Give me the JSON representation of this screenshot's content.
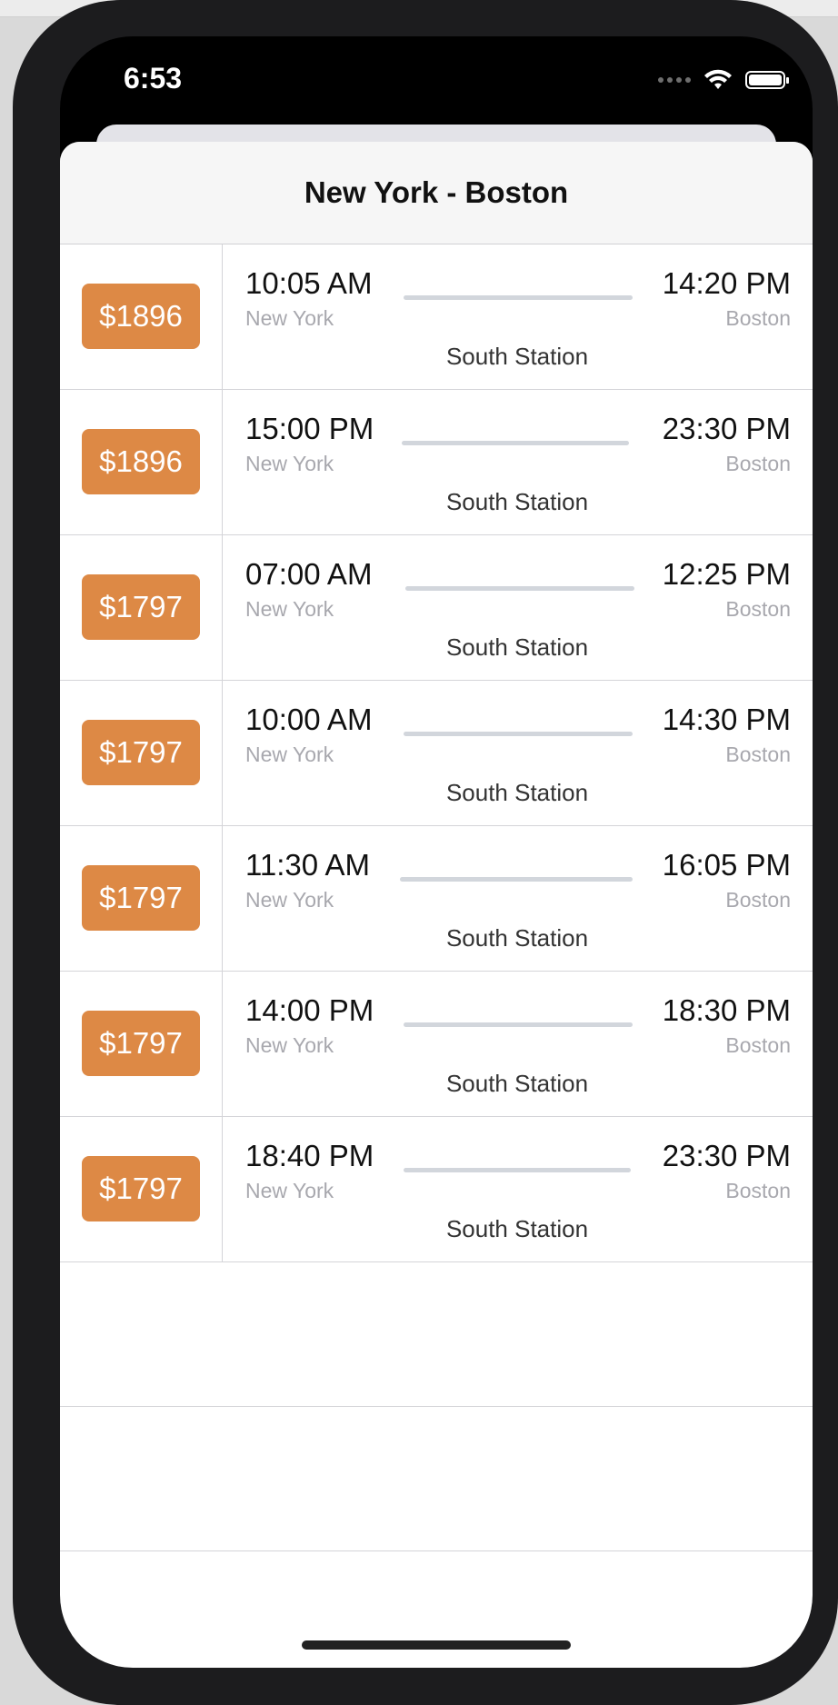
{
  "status_bar": {
    "time": "6:53"
  },
  "header": {
    "title": "New York - Boston"
  },
  "trips": [
    {
      "price": "$1896",
      "departure_time": "10:05 AM",
      "departure_city": "New York",
      "arrival_time": "14:20 PM",
      "arrival_city": "Boston",
      "station": "South Station"
    },
    {
      "price": "$1896",
      "departure_time": "15:00 PM",
      "departure_city": "New York",
      "arrival_time": "23:30 PM",
      "arrival_city": "Boston",
      "station": "South Station"
    },
    {
      "price": "$1797",
      "departure_time": "07:00 AM",
      "departure_city": "New York",
      "arrival_time": "12:25 PM",
      "arrival_city": "Boston",
      "station": "South Station"
    },
    {
      "price": "$1797",
      "departure_time": "10:00 AM",
      "departure_city": "New York",
      "arrival_time": "14:30 PM",
      "arrival_city": "Boston",
      "station": "South Station"
    },
    {
      "price": "$1797",
      "departure_time": "11:30 AM",
      "departure_city": "New York",
      "arrival_time": "16:05 PM",
      "arrival_city": "Boston",
      "station": "South Station"
    },
    {
      "price": "$1797",
      "departure_time": "14:00 PM",
      "departure_city": "New York",
      "arrival_time": "18:30 PM",
      "arrival_city": "Boston",
      "station": "South Station"
    },
    {
      "price": "$1797",
      "departure_time": "18:40 PM",
      "departure_city": "New York",
      "arrival_time": "23:30 PM",
      "arrival_city": "Boston",
      "station": "South Station"
    }
  ],
  "colors": {
    "price_button": "#dd8945",
    "route_line": "#d2d6dc",
    "secondary_text": "#a8a8ae"
  },
  "icons": {
    "wifi": "wifi-icon",
    "battery": "battery-icon",
    "signal": "cellular-signal-icon"
  }
}
